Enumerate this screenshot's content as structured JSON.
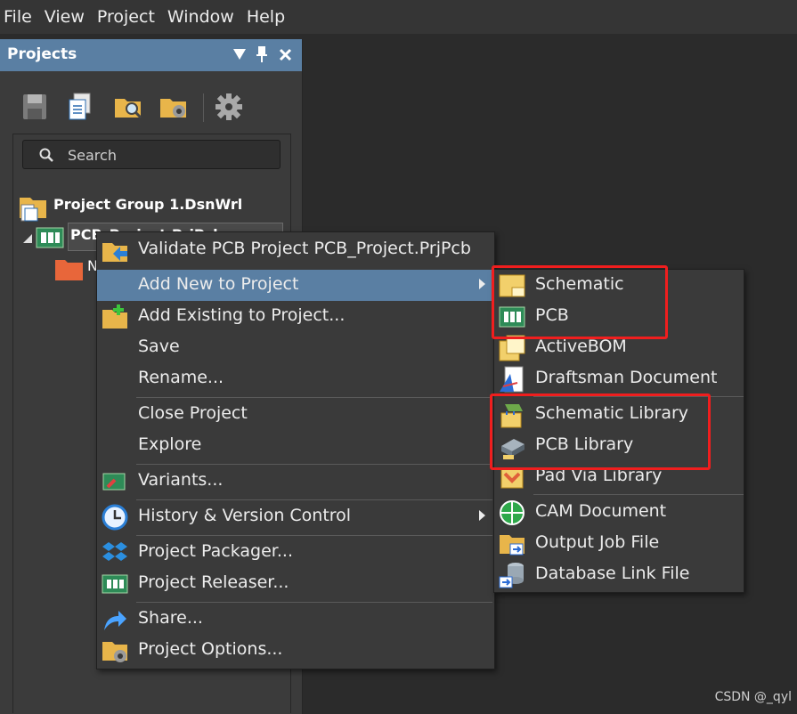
{
  "menubar": [
    {
      "label": "File",
      "name": "menu-file"
    },
    {
      "label": "View",
      "name": "menu-view"
    },
    {
      "label": "Project",
      "name": "menu-project"
    },
    {
      "label": "Window",
      "name": "menu-window"
    },
    {
      "label": "Help",
      "name": "menu-help"
    }
  ],
  "panel": {
    "title": "Projects",
    "header_icons": [
      "dropdown-arrow-icon",
      "pin-icon",
      "close-icon"
    ],
    "toolbar_icons": [
      "save-icon",
      "copy-documents-icon",
      "open-folder-icon",
      "folder-settings-icon",
      "gear-icon"
    ],
    "search_placeholder": "Search"
  },
  "tree": {
    "group_label": "Project Group 1.DsnWrl",
    "project_label": "PCB_Project.PrjPcb",
    "project_label_visible": "PCB_Project.PrjPcb",
    "folder_label_visible": "N"
  },
  "context_menu": {
    "items": [
      {
        "label": "Validate PCB Project PCB_Project.PrjPcb",
        "icon": "validate-icon"
      },
      {
        "label": "Add New to Project",
        "icon": "",
        "submenu": true,
        "highlighted": true
      },
      {
        "label": "Add Existing to Project...",
        "icon": "add-existing-icon"
      },
      {
        "label": "Save",
        "icon": ""
      },
      {
        "label": "Rename...",
        "icon": ""
      },
      {
        "label": "Close Project",
        "icon": ""
      },
      {
        "label": "Explore",
        "icon": ""
      },
      {
        "label": "Variants...",
        "icon": "variants-icon"
      },
      {
        "label": "History & Version Control",
        "icon": "history-clock-icon",
        "submenu": true
      },
      {
        "label": "Project Packager...",
        "icon": "packager-icon"
      },
      {
        "label": "Project Releaser...",
        "icon": "releaser-icon"
      },
      {
        "label": "Share...",
        "icon": "share-arrow-icon"
      },
      {
        "label": "Project Options...",
        "icon": "project-options-icon"
      }
    ]
  },
  "submenu": {
    "items": [
      {
        "label": "Schematic",
        "icon": "schematic-icon"
      },
      {
        "label": "PCB",
        "icon": "pcb-icon"
      },
      {
        "label": "ActiveBOM",
        "icon": "activebom-icon"
      },
      {
        "label": "Draftsman Document",
        "icon": "draftsman-icon"
      },
      {
        "label": "Schematic Library",
        "icon": "schematic-library-icon"
      },
      {
        "label": "PCB Library",
        "icon": "pcb-library-icon"
      },
      {
        "label": "Pad Via Library",
        "icon": "pad-via-library-icon"
      },
      {
        "label": "CAM Document",
        "icon": "cam-document-icon"
      },
      {
        "label": "Output Job File",
        "icon": "output-job-icon"
      },
      {
        "label": "Database Link File",
        "icon": "database-link-icon"
      }
    ]
  },
  "watermark": "CSDN @_qyl",
  "colors": {
    "accent": "#5a7fa3",
    "highlight_box": "#f01e1e",
    "background": "#2b2b2b"
  }
}
